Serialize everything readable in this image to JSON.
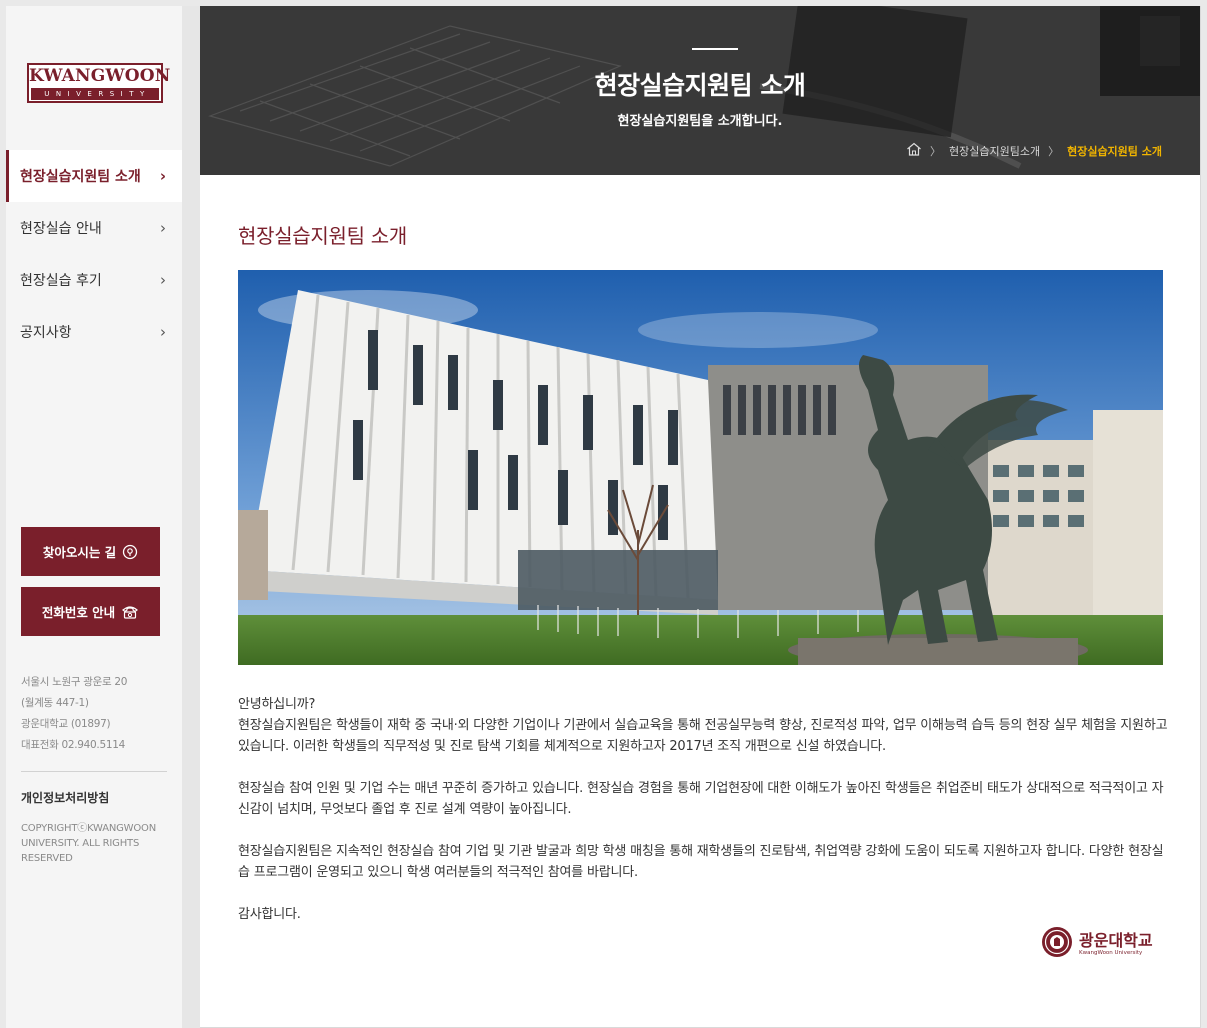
{
  "logo": {
    "main": "KWANGWOON",
    "sub": "UNIVERSITY"
  },
  "nav": {
    "items": [
      {
        "label": "현장실습지원팀 소개",
        "active": true
      },
      {
        "label": "현장실습 안내",
        "active": false
      },
      {
        "label": "현장실습 후기",
        "active": false
      },
      {
        "label": "공지사항",
        "active": false
      }
    ],
    "chevron": "›"
  },
  "side_buttons": {
    "directions": {
      "label": "찾아오시는 길",
      "icon": "location-pin-icon"
    },
    "phone": {
      "label": "전화번호 안내",
      "icon": "phone-icon"
    }
  },
  "address": {
    "line1": "서울시 노원구 광운로 20",
    "line2": "(월계동 447-1)",
    "line3": "광운대학교 (01897)",
    "line4": "대표전화 02.940.5114"
  },
  "footer": {
    "privacy": "개인정보처리방침",
    "copyright": "COPYRIGHTⓒKWANGWOON UNIVERSITY. ALL RIGHTS RESERVED"
  },
  "banner": {
    "title": "현장실습지원팀 소개",
    "subtitle": "현장실습지원팀을 소개합니다.",
    "breadcrumb": [
      "현장실습지원팀소개",
      "현장실습지원팀 소개"
    ],
    "separator": "〉"
  },
  "content": {
    "title": "현장실습지원팀 소개",
    "greeting": "안녕하십니까?",
    "para1": "현장실습지원팀은 학생들이 재학 중 국내·외 다양한 기업이나 기관에서 실습교육을 통해 전공실무능력 향상, 진로적성 파악, 업무 이해능력 습득 등의 현장 실무 체험을 지원하고 있습니다. 이러한 학생들의 직무적성 및 진로 탐색 기회를 체계적으로 지원하고자 2017년 조직 개편으로 신설 하였습니다.",
    "para2": "현장실습 참여 인원 및 기업 수는 매년 꾸준히 증가하고 있습니다. 현장실습 경험을 통해 기업현장에 대한 이해도가 높아진 학생들은 취업준비 태도가 상대적으로 적극적이고 자신감이 넘치며, 무엇보다 졸업 후 진로 설계 역량이 높아집니다.",
    "para3": "현장실습지원팀은 지속적인 현장실습 참여 기업 및 기관 발굴과 희망 학생 매칭을 통해 재학생들의 진로탐색, 취업역량 강화에 도움이 되도록 지원하고자 합니다. 다양한 현장실습 프로그램이 운영되고 있으니 학생 여러분들의 적극적인 참여를 바랍니다.",
    "closing": "감사합니다."
  },
  "seal": {
    "ko": "광운대학교",
    "en": "KwangWoon University"
  },
  "colors": {
    "brand": "#7a1f2b",
    "breadcrumb_current": "#f0b400"
  }
}
